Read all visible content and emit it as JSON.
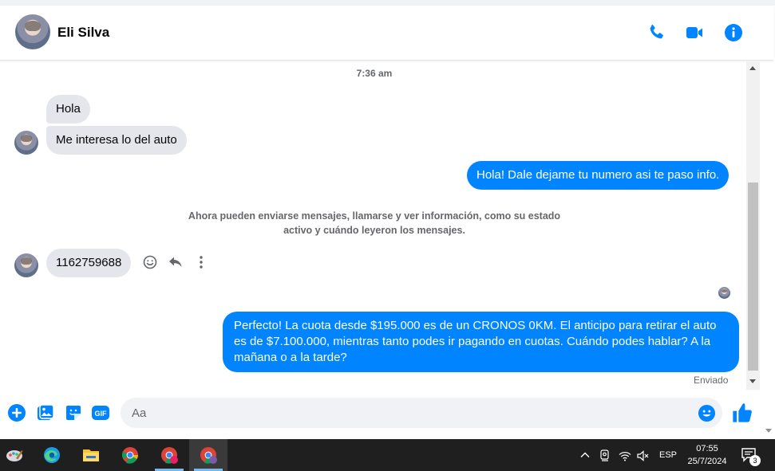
{
  "header": {
    "contact_name": "Eli Silva",
    "icons": [
      "phone-icon",
      "video-icon",
      "info-icon"
    ]
  },
  "conversation": {
    "timestamp": "7:36 am",
    "incoming_1": [
      "Hola",
      "Me interesa lo del auto"
    ],
    "outgoing_1": "Hola! Dale dejame tu numero  asi te paso info.",
    "system_note": "Ahora pueden enviarse mensajes, llamarse y ver información, como su estado activo y cuándo leyeron los mensajes.",
    "incoming_2": "1162759688",
    "outgoing_2": "Perfecto! La cuota desde $195.000 es de un CRONOS 0KM. El anticipo para retirar el auto es de $7.100.000, mientras tanto podes ir pagando en cuotas. Cuándo podes hablar? A la mañana o a la tarde?",
    "sent_status": "Enviado"
  },
  "composer": {
    "placeholder": "Aa"
  },
  "taskbar": {
    "language": "ESP",
    "time": "07:55",
    "date": "25/7/2024",
    "notification_count": "3"
  },
  "colors": {
    "accent": "#0084ff",
    "incoming_bubble": "#e4e6eb",
    "taskbar": "#1f1f1f"
  }
}
